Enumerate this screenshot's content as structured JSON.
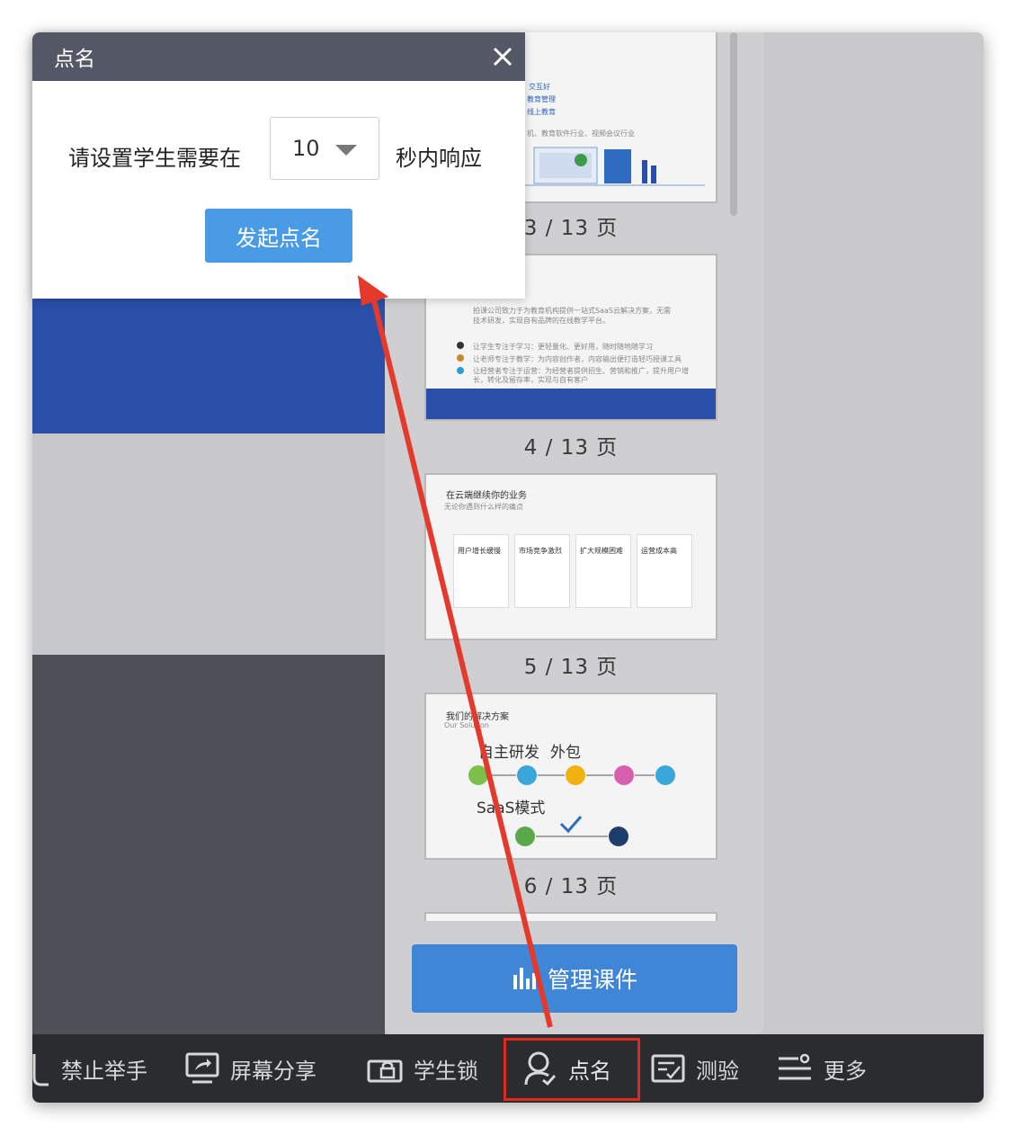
{
  "modal": {
    "title": "点名",
    "prompt_before": "请设置学生需要在",
    "selected_seconds": "10",
    "prompt_after": "秒内响应",
    "start_button": "发起点名",
    "close_icon": "close-icon"
  },
  "thumbnails": {
    "pages": [
      {
        "label": "3 / 13 页"
      },
      {
        "label": "4 / 13 页"
      },
      {
        "label": "5 / 13 页"
      },
      {
        "label": "6 / 13 页"
      }
    ],
    "thumb3": {
      "lines": [
        "交互好",
        "教育管理",
        "线上教育",
        "机、教育软件行业、视频会议行业"
      ]
    },
    "thumb4": {
      "intro": "拍课公司致力于为教育机构提供一站式SaaS云解决方案，无需技术研发，实现自有品牌的在线教学平台。",
      "items": [
        "让学生专注于学习：更轻量化、更好用，随时随地随学习",
        "让老师专注于教学：为内容创作者，内容输出便打造轻巧授课工具",
        "让经营者专注于运营：为经营者提供招生、营销和推广，提升用户增长，转化及留存率，实现与自有客户"
      ]
    },
    "thumb5": {
      "title": "在云端继续你的业务",
      "subtitle": "无论你遇到什么样的痛点",
      "cards": [
        "用户增长缓慢",
        "市场竞争激烈",
        "扩大规模困难",
        "运营成本高"
      ]
    },
    "thumb6": {
      "title": "我们的解决方案",
      "subtitle": "Our Solution",
      "option1": "自主研发",
      "option2": "外包",
      "option3": "SaaS模式"
    }
  },
  "manage_button": "管理课件",
  "toolbar": {
    "items": [
      {
        "label": "禁止举手",
        "icon": "hand-icon"
      },
      {
        "label": "屏幕分享",
        "icon": "screen-share-icon"
      },
      {
        "label": "学生锁",
        "icon": "lock-icon"
      },
      {
        "label": "点名",
        "icon": "user-check-icon"
      },
      {
        "label": "测验",
        "icon": "quiz-icon"
      },
      {
        "label": "更多",
        "icon": "more-icon"
      }
    ]
  },
  "colors": {
    "highlight": "#e0281f",
    "primary_button": "#4a9be6",
    "manage_button": "#3f86d6",
    "modal_header": "#545866",
    "toolbar": "#2b2c2f"
  }
}
